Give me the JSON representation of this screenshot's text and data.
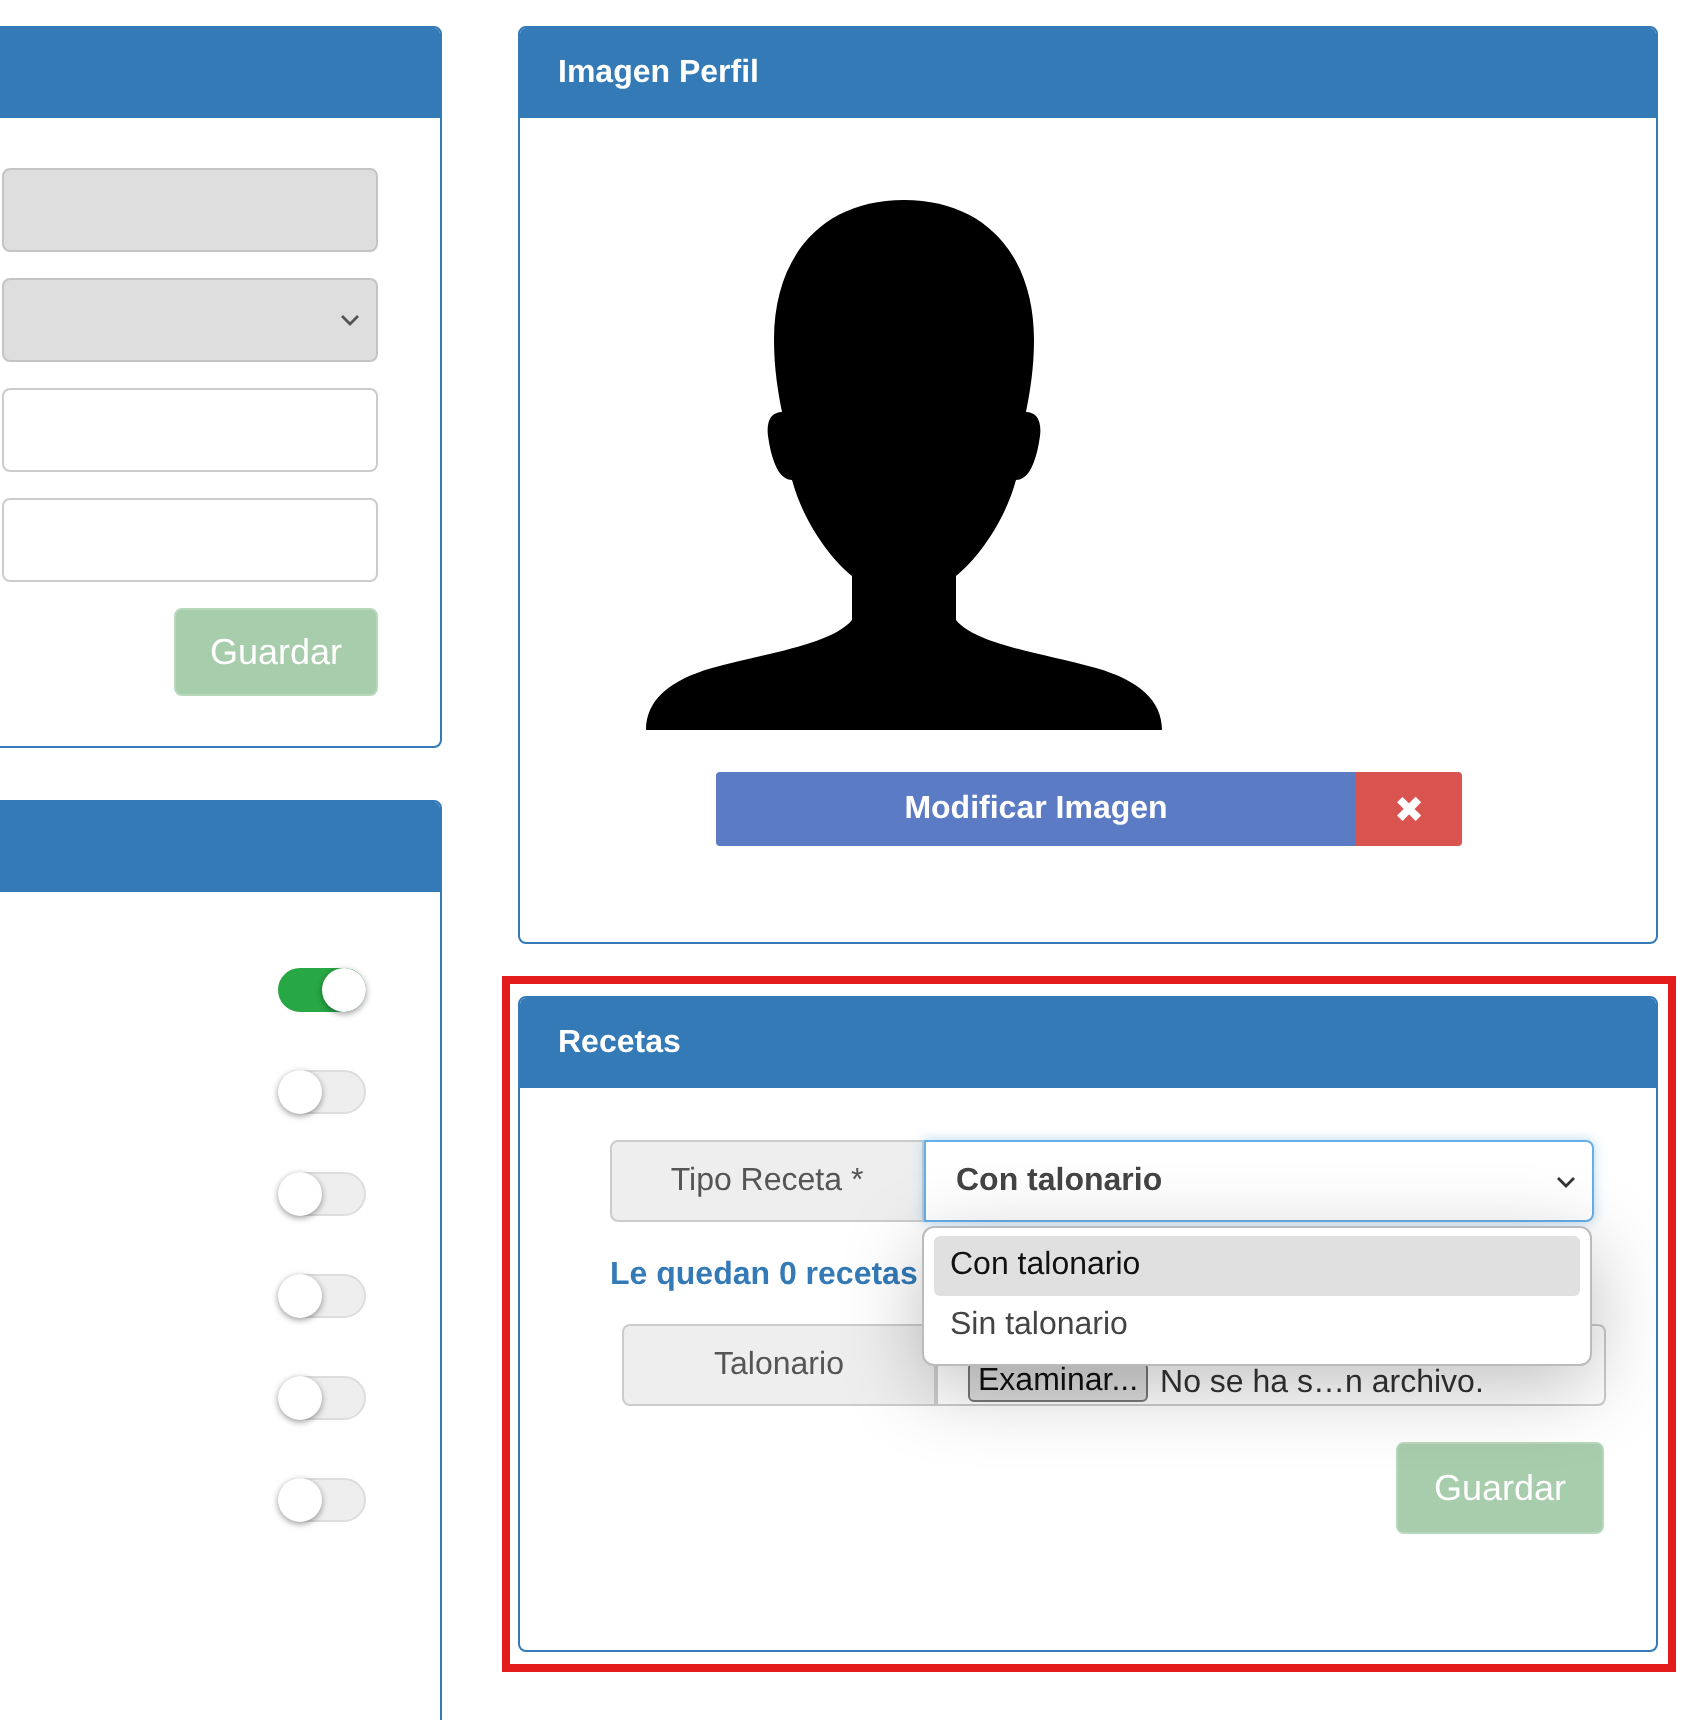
{
  "left_panels": [
    {
      "fields": [
        {
          "kind": "input",
          "disabled": true
        },
        {
          "kind": "select",
          "disabled": true
        },
        {
          "kind": "input",
          "disabled": false
        },
        {
          "kind": "input",
          "disabled": false
        }
      ],
      "save_button": {
        "label": "Guardar",
        "disabled": true
      }
    },
    {
      "toggles": [
        {
          "on": true
        },
        {
          "on": false
        },
        {
          "on": false
        },
        {
          "on": false
        },
        {
          "on": false
        },
        {
          "on": false
        }
      ]
    }
  ],
  "profile_image": {
    "title": "Imagen Perfil",
    "modify_button": "Modificar Imagen",
    "delete_button": "✖"
  },
  "recetas": {
    "title": "Recetas",
    "highlighted": true,
    "tipo_receta": {
      "label": "Tipo Receta *",
      "value": "Con talonario",
      "expanded": true,
      "options": [
        {
          "label": "Con talonario",
          "selected": true
        },
        {
          "label": "Sin talonario",
          "selected": false
        }
      ]
    },
    "remaining": "Le quedan 0 recetas",
    "talonario": {
      "label": "Talonario",
      "browse_button": "Examinar...",
      "file_status": "No se ha s…n archivo."
    },
    "save_button": {
      "label": "Guardar",
      "disabled": true
    }
  }
}
